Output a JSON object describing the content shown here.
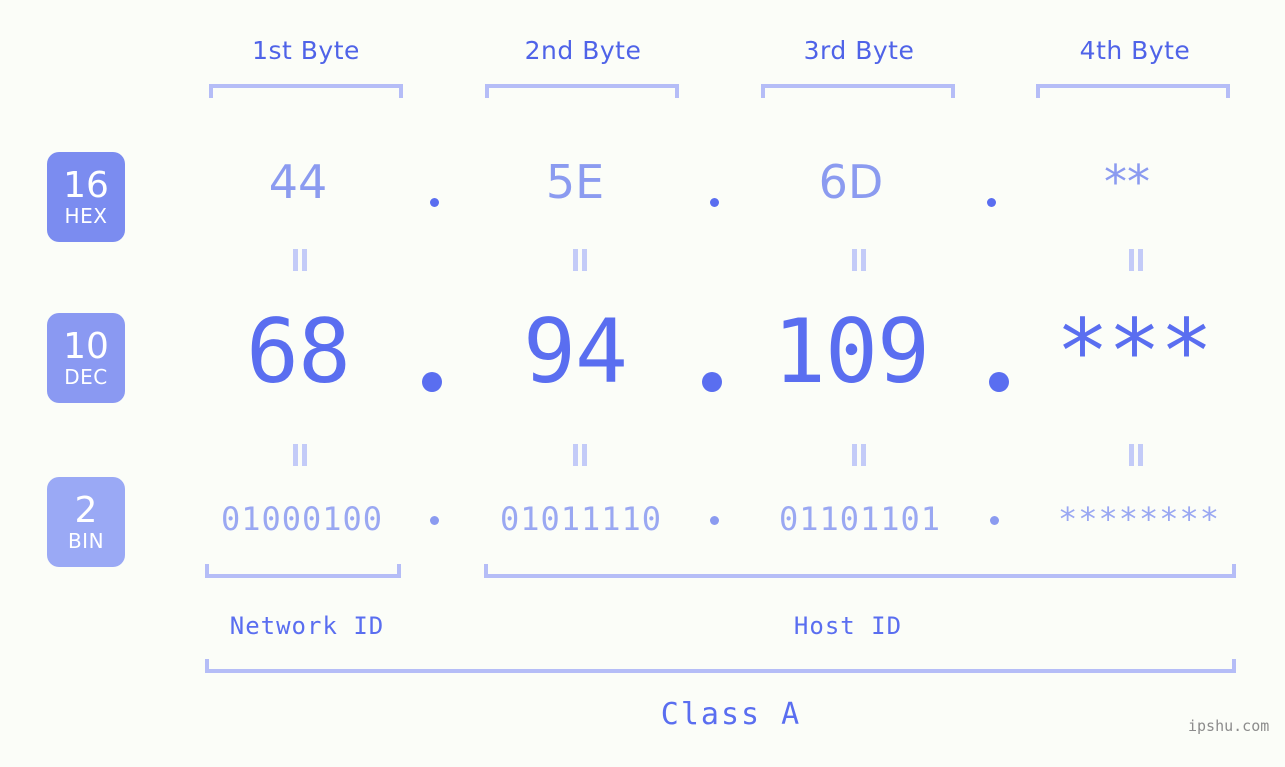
{
  "meta": {
    "watermark": "ipshu.com",
    "background_color": "#fbfdf8",
    "accent_color": "#5a6ef0",
    "bracket_color": "#b5bdf7"
  },
  "byte_headers": [
    {
      "label": "1st Byte"
    },
    {
      "label": "2nd Byte"
    },
    {
      "label": "3rd Byte"
    },
    {
      "label": "4th Byte"
    }
  ],
  "bases": [
    {
      "number": "16",
      "name": "HEX",
      "color": "#7b8cf0"
    },
    {
      "number": "10",
      "name": "DEC",
      "color": "#8a99f2"
    },
    {
      "number": "2",
      "name": "BIN",
      "color": "#9aa9f5"
    }
  ],
  "rows": {
    "hex": {
      "values": [
        "44",
        "5E",
        "6D",
        "**"
      ],
      "separator": "."
    },
    "dec": {
      "values": [
        "68",
        "94",
        "109",
        "***"
      ],
      "separator": "."
    },
    "bin": {
      "values": [
        "01000100",
        "01011110",
        "01101101",
        "********"
      ],
      "separator": "."
    }
  },
  "equals_marks": {
    "symbol": "=",
    "rows": 2,
    "count_per_row": 4
  },
  "sections": [
    {
      "label": "Network ID"
    },
    {
      "label": "Host ID"
    }
  ],
  "class": {
    "label": "Class A"
  }
}
